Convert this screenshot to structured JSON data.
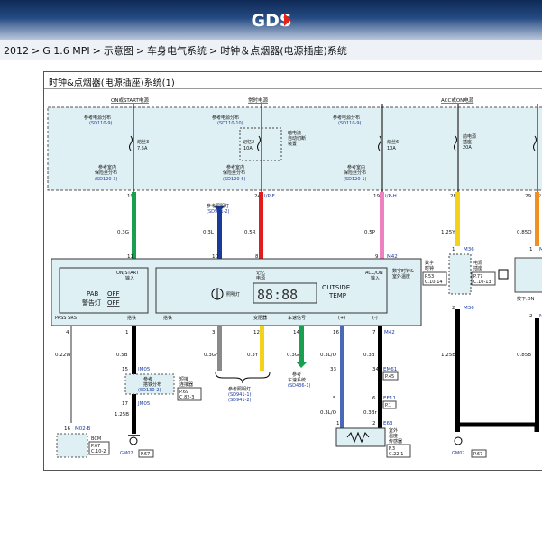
{
  "header": {
    "logo_text": "GDS",
    "logo_accent": "#e2231a"
  },
  "breadcrumb": {
    "items": [
      "2012",
      "G 1.6 MPI",
      "示意图",
      "车身电气系统",
      "时钟＆点烟器(电源插座)系统"
    ],
    "separator": ">"
  },
  "panel": {
    "title": "时钟&点烟器(电源插座)系统(1)"
  },
  "diagram": {
    "power_labels": [
      "ON或START电源",
      "常时电源",
      "ACC或ON电源"
    ],
    "ref_power_1": "参考电源分布",
    "ref_power_1_code": "(SD110-9)",
    "ref_power_2": "参考电源分布",
    "ref_power_2_code": "(SD110-10)",
    "ref_power_3": "参考电源分布",
    "ref_power_3_code": "(SD110-9)",
    "fuse_3": "熔丝3",
    "fuse_3_rating": "7.5A",
    "fuse_memory": "记忆2",
    "fuse_memory_rating": "10A",
    "auto_cut_1": "暗电流",
    "auto_cut_2": "自动切断",
    "auto_cut_3": "装置",
    "fuse_6": "熔丝6",
    "fuse_6_rating": "10A",
    "fuse_front": "前电源",
    "fuse_front_2": "插座",
    "fuse_front_rating": "20A",
    "ref_room_a": "参考室内",
    "ref_room_b": "保险丝分布",
    "ref_room_code_1": "(SD120-3)",
    "ref_room_code_2": "(SD120-6)",
    "ref_room_code_3": "(SD120-1)",
    "pin_19a": "19",
    "pin_24": "24",
    "pin_19b": "19",
    "pin_28": "28",
    "pin_29": "29",
    "conn_ipf": "I/P-F",
    "conn_iph": "I/P-H",
    "conn_ip_edge": "I/P",
    "ref_light_1": "参考照明灯",
    "ref_light_1_code": "(SD941-2)",
    "wire_03g": "0.3G",
    "wire_03l": "0.3L",
    "wire_05r": "0.5R",
    "wire_05p": "0.5P",
    "wire_125y": "1.25Y",
    "wire_085o": "0.85O",
    "pin_11": "11",
    "pin_10": "10",
    "pin_8": "8",
    "pin_9": "9",
    "conn_m42": "M42",
    "pin_1a": "1",
    "conn_m36": "M36",
    "pin_1b": "1",
    "conn_m3": "M3",
    "clock_lbl_1": "数字",
    "clock_lbl_2": "时钟",
    "clock_code_1": "P.53",
    "clock_code_2": "C.10-14",
    "socket_lbl_1": "电源",
    "socket_lbl_2": "插座",
    "socket_code_1": "P.77",
    "socket_code_2": "C.10-13",
    "press_on": "按下:ON",
    "digit_clock_1": "数字时钟&",
    "digit_clock_2": "室外温度",
    "on_start_1": "ON/START",
    "on_start_2": "输入",
    "memory_1": "记忆",
    "memory_2": "电源",
    "acc_on_1": "ACC/ON",
    "acc_on_2": "输入",
    "pab_1": "PAB",
    "pab_2": "OFF",
    "pab_3": "警告灯",
    "pab_4": "OFF",
    "illum": "照明灯",
    "outside": "OUTSIDE",
    "temp": "TEMP",
    "pass_srs": "PASS SRS",
    "gnd_1": "搭铁",
    "gnd_2": "搭铁",
    "dimmer": "变阻器",
    "speed": "车速信号",
    "plus": "(+)",
    "minus": "(-)",
    "pin_2a": "2",
    "pin_2b": "2",
    "conn_m36b": "M36",
    "conn_m3b": "M3",
    "pin_4": "4",
    "pin_1c": "1",
    "pin_3": "3",
    "pin_12": "12",
    "pin_14": "14",
    "pin_16": "16",
    "pin_7": "7",
    "conn_m42b": "M42",
    "wire_022w": "0.22W",
    "wire_05b": "0.5B",
    "wire_03gr": "0.3Gr",
    "wire_03y": "0.3Y",
    "wire_03g2": "0.3G",
    "wire_03lo": "0.3L/O",
    "wire_03b": "0.3B",
    "wire_125b": "1.25B",
    "wire_085b": "0.85B",
    "pin_15": "15",
    "conn_jm05": "JM05",
    "ref_gnd_1": "参考",
    "ref_gnd_2": "搭铁分布",
    "ref_gnd_code": "(SD130-2)",
    "short_1": "短接",
    "short_2": "连接器",
    "short_code_1": "P.69",
    "short_code_2": "C.82-3",
    "pin_17": "17",
    "conn_jm05b": "JM05",
    "wire_125b2": "1.25B",
    "ref_light_2": "参考照明灯",
    "ref_light_2_code1": "(SD941-1)",
    "ref_light_2_code2": "(SD941-2)",
    "ref_speed_1": "参考",
    "ref_speed_2": "车速系统",
    "ref_speed_code": "(SD436-1)",
    "pin_33": "33",
    "pin_34": "34",
    "conn_em61": "EM61",
    "em61_code": "P.45",
    "pin_5": "5",
    "pin_6": "6",
    "conn_ee11": "EE11",
    "ee11_code": "P.1",
    "wire_03lo2": "0.3L/O",
    "wire_03br": "0.3Br",
    "pin_1d": "1",
    "pin_2c": "2",
    "conn_e63": "E63",
    "sensor_1": "室外",
    "sensor_2": "温度",
    "sensor_3": "传感器",
    "sensor_code_1": "P.3",
    "sensor_code_2": "C.22-1",
    "pin_16b": "16",
    "conn_m028": "M02-B",
    "bcm": "BCM",
    "bcm_code_1": "P.67",
    "bcm_code_2": "C.10-2",
    "gnd_gm02a": "GM02",
    "gnd_gm02a_code": "P.67",
    "gnd_gm02b": "GM02",
    "gnd_gm02b_code": "P.67"
  }
}
